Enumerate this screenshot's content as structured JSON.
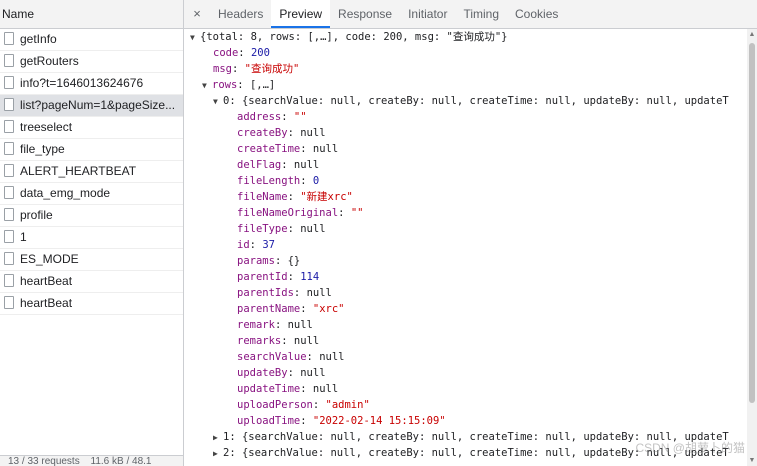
{
  "left_panel": {
    "header": "Name",
    "requests": [
      {
        "name": "getInfo"
      },
      {
        "name": "getRouters"
      },
      {
        "name": "info?t=1646013624676"
      },
      {
        "name": "list?pageNum=1&pageSize..."
      },
      {
        "name": "treeselect"
      },
      {
        "name": "file_type"
      },
      {
        "name": "ALERT_HEARTBEAT"
      },
      {
        "name": "data_emg_mode"
      },
      {
        "name": "profile"
      },
      {
        "name": "1"
      },
      {
        "name": "ES_MODE"
      },
      {
        "name": "heartBeat"
      },
      {
        "name": "heartBeat"
      }
    ],
    "selected_index": 3,
    "footer": {
      "requests": "13 / 33 requests",
      "size": "11.6 kB / 48.1"
    }
  },
  "tabs": {
    "close": "×",
    "items": [
      "Headers",
      "Preview",
      "Response",
      "Initiator",
      "Timing",
      "Cookies"
    ],
    "active": "Preview"
  },
  "preview": {
    "root_summary": "{total: 8, rows: [,…], code: 200, msg: \"查询成功\"}",
    "code_key": "code",
    "code_value": "200",
    "msg_key": "msg",
    "msg_value": "\"查询成功\"",
    "rows_key": "rows",
    "rows_summary": "[,…]",
    "row0_summary": "0: {searchValue: null, createBy: null, createTime: null, updateBy: null, updateT",
    "fields": [
      {
        "key": "address",
        "value": "\"\"",
        "type": "string"
      },
      {
        "key": "createBy",
        "value": "null",
        "type": "null"
      },
      {
        "key": "createTime",
        "value": "null",
        "type": "null"
      },
      {
        "key": "delFlag",
        "value": "null",
        "type": "null"
      },
      {
        "key": "fileLength",
        "value": "0",
        "type": "number"
      },
      {
        "key": "fileName",
        "value": "\"新建xrc\"",
        "type": "string"
      },
      {
        "key": "fileNameOriginal",
        "value": "\"\"",
        "type": "string"
      },
      {
        "key": "fileType",
        "value": "null",
        "type": "null"
      },
      {
        "key": "id",
        "value": "37",
        "type": "number"
      },
      {
        "key": "params",
        "value": "{}",
        "type": "plain"
      },
      {
        "key": "parentId",
        "value": "114",
        "type": "number"
      },
      {
        "key": "parentIds",
        "value": "null",
        "type": "null"
      },
      {
        "key": "parentName",
        "value": "\"xrc\"",
        "type": "string"
      },
      {
        "key": "remark",
        "value": "null",
        "type": "null"
      },
      {
        "key": "remarks",
        "value": "null",
        "type": "null"
      },
      {
        "key": "searchValue",
        "value": "null",
        "type": "null"
      },
      {
        "key": "updateBy",
        "value": "null",
        "type": "null"
      },
      {
        "key": "updateTime",
        "value": "null",
        "type": "null"
      },
      {
        "key": "uploadPerson",
        "value": "\"admin\"",
        "type": "string"
      },
      {
        "key": "uploadTime",
        "value": "\"2022-02-14 15:15:09\"",
        "type": "string"
      }
    ],
    "row1_summary": "1: {searchValue: null, createBy: null, createTime: null, updateBy: null, updateT",
    "row2_summary": "2: {searchValue: null, createBy: null, createTime: null, updateBy: null, updateT"
  },
  "watermark": "CSDN @胡萝卜的猫",
  "colors": {
    "key": "#881280",
    "string": "#c80000",
    "number": "#1a1aa6",
    "tab_active": "#1a73e8"
  }
}
